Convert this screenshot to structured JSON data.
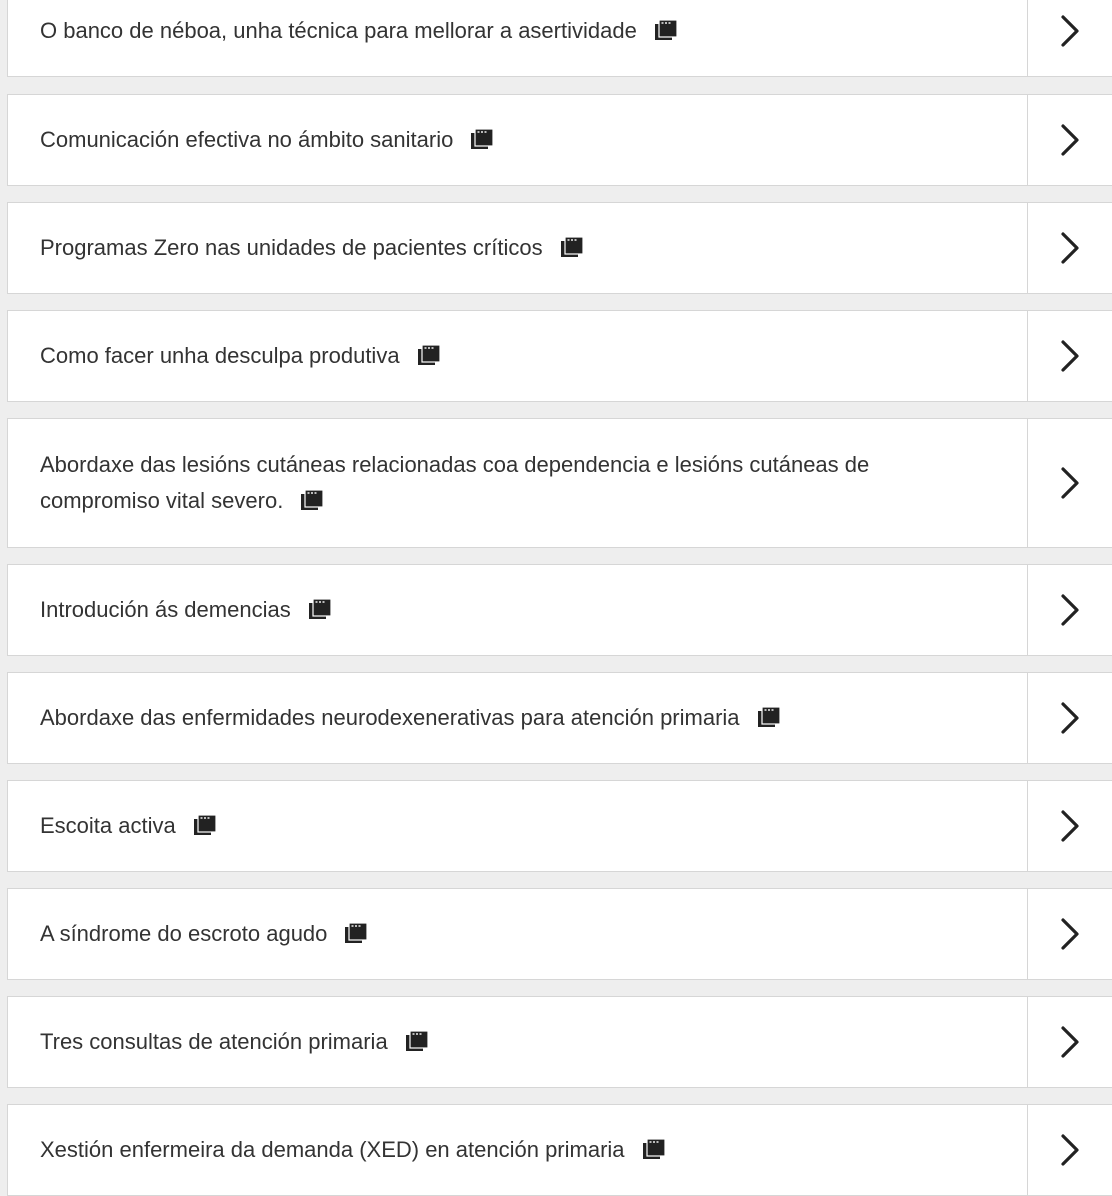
{
  "courses": [
    {
      "title": "O banco de néboa, unha técnica para mellorar a asertividade",
      "icon": "window-icon",
      "arrow": "chevron-right-icon"
    },
    {
      "title": "Comunicación efectiva no ámbito sanitario",
      "icon": "window-icon",
      "arrow": "chevron-right-icon"
    },
    {
      "title": "Programas Zero nas unidades de pacientes críticos",
      "icon": "window-icon",
      "arrow": "chevron-right-icon"
    },
    {
      "title": "Como facer unha desculpa produtiva",
      "icon": "window-icon",
      "arrow": "chevron-right-icon"
    },
    {
      "title": "Abordaxe das lesións cutáneas relacionadas coa dependencia e lesións cutáneas de compromiso vital severo.",
      "icon": "window-icon",
      "arrow": "chevron-right-icon"
    },
    {
      "title": "Introdución ás demencias",
      "icon": "window-icon",
      "arrow": "chevron-right-icon"
    },
    {
      "title": "Abordaxe das enfermidades neurodexenerativas para atención primaria",
      "icon": "window-icon",
      "arrow": "chevron-right-icon"
    },
    {
      "title": "Escoita activa",
      "icon": "window-icon",
      "arrow": "chevron-right-icon"
    },
    {
      "title": "A síndrome do escroto agudo",
      "icon": "window-icon",
      "arrow": "chevron-right-icon"
    },
    {
      "title": "Tres consultas de atención primaria",
      "icon": "window-icon",
      "arrow": "chevron-right-icon"
    },
    {
      "title": "Xestión enfermeira da demanda (XED) en atención primaria",
      "icon": "window-icon",
      "arrow": "chevron-right-icon"
    }
  ],
  "colors": {
    "page_background": "#eeeeee",
    "card_background": "#ffffff",
    "border": "#d6d6d6",
    "text": "#333333",
    "icon": "#222222"
  }
}
